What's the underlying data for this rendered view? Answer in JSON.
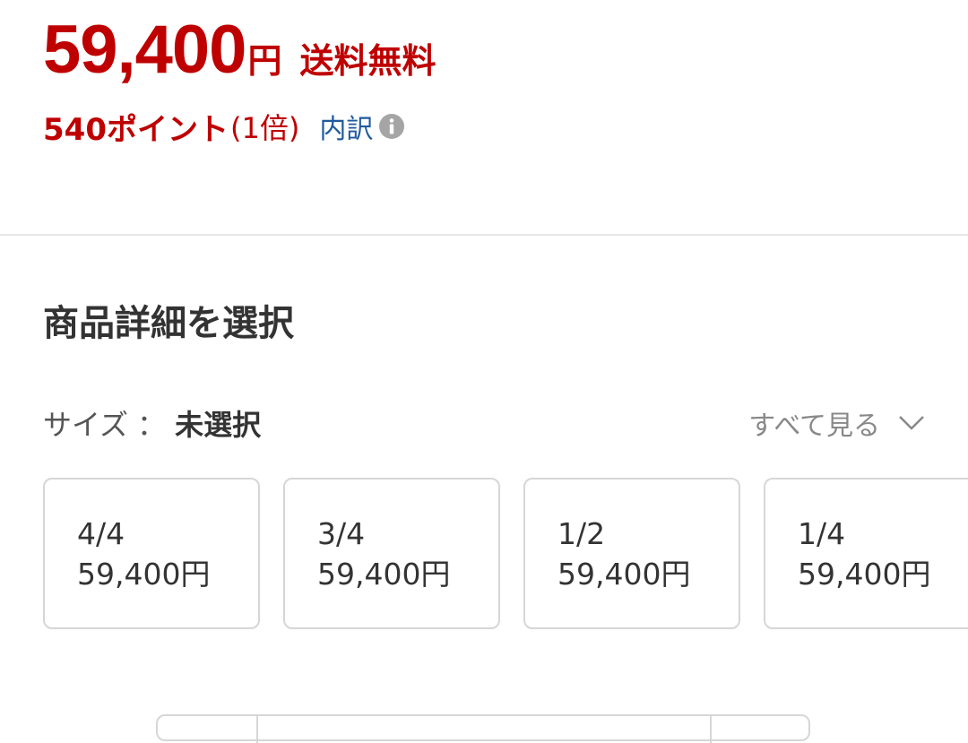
{
  "price": {
    "amount": "59,400",
    "currency": "円",
    "shipping_label": "送料無料"
  },
  "points": {
    "label": "540ポイント",
    "rate": "(1倍)",
    "breakdown_link": "内訳",
    "info_icon": "info-circle-icon"
  },
  "section": {
    "title": "商品詳細を選択"
  },
  "size_selector": {
    "label": "サイズ",
    "colon": "：",
    "value": "未選択",
    "see_all": "すべて見る",
    "see_all_icon": "chevron-down-icon",
    "options": [
      {
        "size": "4/4",
        "price": "59,400円"
      },
      {
        "size": "3/4",
        "price": "59,400円"
      },
      {
        "size": "1/2",
        "price": "59,400円"
      },
      {
        "size": "1/4",
        "price": "59,400円"
      }
    ]
  },
  "colors": {
    "price_red": "#bf0000",
    "link_blue": "#1f5a9e",
    "border_gray": "#d6d6d6",
    "muted_gray": "#888888"
  }
}
